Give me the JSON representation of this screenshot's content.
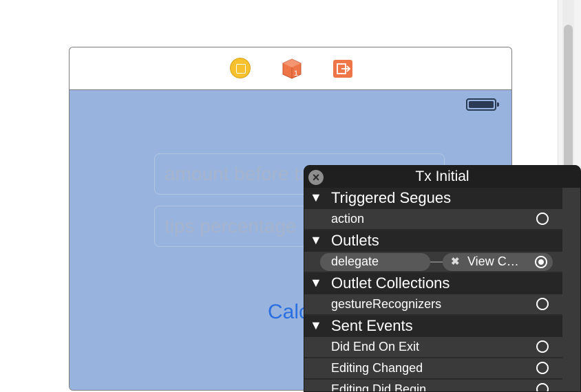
{
  "scene": {
    "dock_icons": [
      "view-controller-icon",
      "first-responder-icon",
      "exit-icon"
    ],
    "first_responder_badge": "1",
    "textfields": [
      {
        "placeholder": "amount before tax"
      },
      {
        "placeholder": "tips percentage"
      }
    ],
    "calculate_label": "Calc"
  },
  "inspector": {
    "title": "Tx Initial",
    "sections": {
      "triggered_segues": {
        "title": "Triggered Segues",
        "rows": [
          {
            "label": "action"
          }
        ]
      },
      "outlets": {
        "title": "Outlets",
        "rows": [
          {
            "label": "delegate",
            "connected_to": "View C…"
          }
        ]
      },
      "outlet_collections": {
        "title": "Outlet Collections",
        "rows": [
          {
            "label": "gestureRecognizers"
          }
        ]
      },
      "sent_events": {
        "title": "Sent Events",
        "rows": [
          {
            "label": "Did End On Exit"
          },
          {
            "label": "Editing Changed"
          },
          {
            "label": "Editing Did Begin"
          }
        ]
      }
    }
  },
  "colors": {
    "canvas_bg": "#97b3de",
    "popover_bg": "#2b2b2b",
    "accent_blue": "#2a6fe0",
    "vc_yellow": "#f7c12e",
    "exit_orange": "#ee7547"
  }
}
